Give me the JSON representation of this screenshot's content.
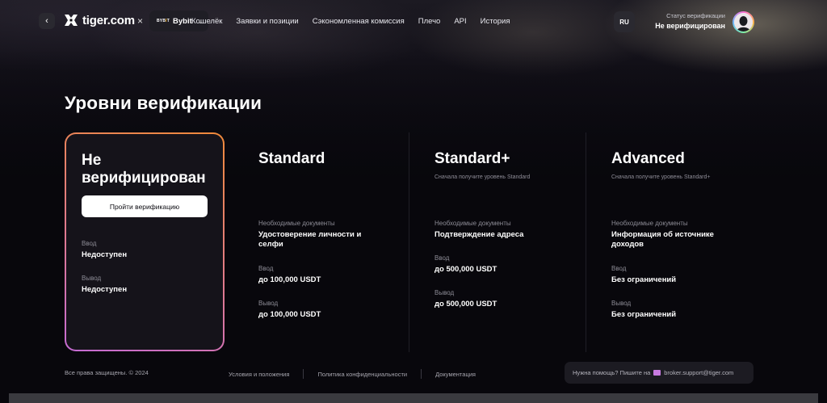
{
  "header": {
    "back_icon": "chevron-left-icon",
    "brand": "tiger.com",
    "times": "×",
    "exchange": {
      "logo_prefix": "BYB",
      "logo_accent": "I",
      "logo_suffix": "T",
      "name": "Bybit",
      "chevron_icon": "chevron-down-icon"
    },
    "nav": [
      "Кошелёк",
      "Заявки и позиции",
      "Сэкономленная комиссия",
      "Плечо",
      "API",
      "История"
    ],
    "lang": "RU",
    "verification": {
      "label": "Статус верификации",
      "value": "Не верифицирован"
    },
    "avatar_icon": "user-avatar-icon"
  },
  "page": {
    "title": "Уровни верификации"
  },
  "levels": [
    {
      "title": "Не верифицирован",
      "button": "Пройти верификацию",
      "deposit_label": "Ввод",
      "deposit_value": "Недоступен",
      "withdraw_label": "Вывод",
      "withdraw_value": "Недоступен",
      "active": true
    },
    {
      "title": "Standard",
      "subtitle": "",
      "docs_label": "Необходимые документы",
      "docs_value": "Удостоверение личности и селфи",
      "deposit_label": "Ввод",
      "deposit_value": "до 100,000 USDT",
      "withdraw_label": "Вывод",
      "withdraw_value": "до 100,000 USDT"
    },
    {
      "title": "Standard+",
      "subtitle": "Сначала получите уровень Standard",
      "docs_label": "Необходимые документы",
      "docs_value": "Подтверждение адреса",
      "deposit_label": "Ввод",
      "deposit_value": "до 500,000 USDT",
      "withdraw_label": "Вывод",
      "withdraw_value": "до 500,000 USDT"
    },
    {
      "title": "Advanced",
      "subtitle": "Сначала получите уровень Standard+",
      "docs_label": "Необходимые документы",
      "docs_value": "Информация об источнике доходов",
      "deposit_label": "Ввод",
      "deposit_value": "Без ограничений",
      "withdraw_label": "Вывод",
      "withdraw_value": "Без ограничений"
    }
  ],
  "footer": {
    "copyright": "Все права защищены. © 2024",
    "links": [
      "Условия и положения",
      "Политика конфиденциальности",
      "Документация"
    ],
    "help_text": "Нужна помощь? Пишите на",
    "mail_icon": "mail-icon",
    "email": "broker.support@tiger.com"
  },
  "colors": {
    "background": "#08070c",
    "card_gradient_start": "#f08a3a",
    "card_gradient_end": "#c56bd4",
    "accent_bybit": "#f7a600"
  }
}
